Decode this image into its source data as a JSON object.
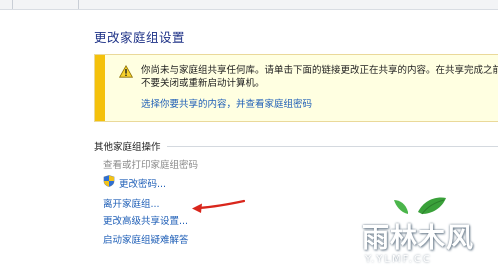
{
  "page_title": "更改家庭组设置",
  "warning": {
    "line1": "你尚未与家庭组共享任何库。请单击下面的链接更改正在共享的内容。在共享完成之前",
    "line2": "不要关闭或重新启动计算机。",
    "link": "选择你要共享的内容，并查看家庭组密码"
  },
  "other_actions": {
    "header": "其他家庭组操作",
    "items": [
      {
        "label": "查看或打印家庭组密码"
      },
      {
        "label": "更改密码..."
      },
      {
        "label": "离开家庭组..."
      },
      {
        "label": "更改高级共享设置..."
      },
      {
        "label": "启动家庭组疑难解答"
      }
    ]
  },
  "watermark": {
    "title": "雨林木风",
    "url": "Y.YLMF.CC",
    "colors": {
      "text": "#ffffff",
      "leaf": "#3aa13a"
    }
  },
  "colors": {
    "title": "#1e3287",
    "link": "#1f5fb7",
    "warning_bg": "#ffffe1",
    "warning_stripe": "#f4c10b",
    "annotation_arrow": "#d9261c"
  },
  "icons": {
    "warning": "warning-triangle-icon",
    "shield": "uac-shield-icon"
  }
}
